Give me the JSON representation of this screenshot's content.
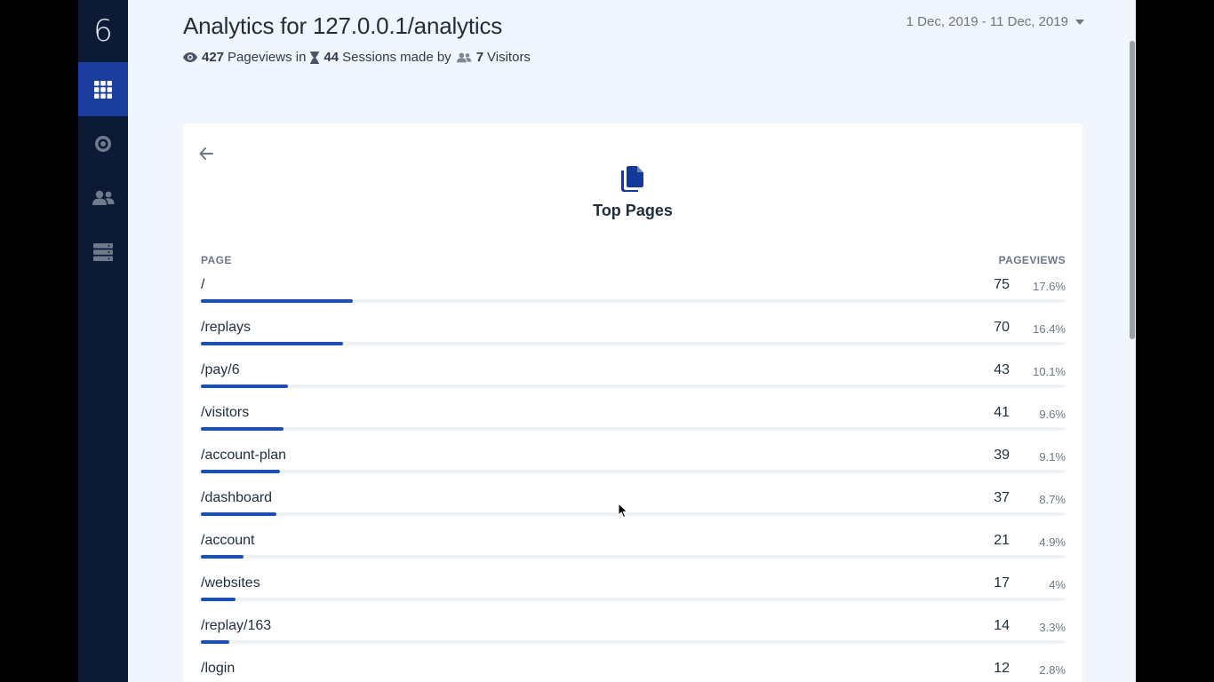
{
  "sidebar": {
    "logo": "6",
    "items": [
      {
        "name": "grid-icon",
        "active": true
      },
      {
        "name": "target-icon",
        "active": false
      },
      {
        "name": "users-icon",
        "active": false
      },
      {
        "name": "server-icon",
        "active": false
      }
    ]
  },
  "header": {
    "title": "Analytics for 127.0.0.1/analytics",
    "stats": {
      "pageviews_count": "427",
      "pageviews_label": "Pageviews in",
      "sessions_count": "44",
      "sessions_label": "Sessions made by",
      "visitors_count": "7",
      "visitors_label": "Visitors"
    },
    "date_range": "1 Dec, 2019 - 11 Dec, 2019"
  },
  "card": {
    "title": "Top Pages",
    "col_page": "PAGE",
    "col_views": "PAGEVIEWS",
    "rows": [
      {
        "page": "/",
        "count": "75",
        "pct": "17.6%",
        "share": 0.176
      },
      {
        "page": "/replays",
        "count": "70",
        "pct": "16.4%",
        "share": 0.164
      },
      {
        "page": "/pay/6",
        "count": "43",
        "pct": "10.1%",
        "share": 0.101
      },
      {
        "page": "/visitors",
        "count": "41",
        "pct": "9.6%",
        "share": 0.096
      },
      {
        "page": "/account-plan",
        "count": "39",
        "pct": "9.1%",
        "share": 0.091
      },
      {
        "page": "/dashboard",
        "count": "37",
        "pct": "8.7%",
        "share": 0.087
      },
      {
        "page": "/account",
        "count": "21",
        "pct": "4.9%",
        "share": 0.049
      },
      {
        "page": "/websites",
        "count": "17",
        "pct": "4%",
        "share": 0.04
      },
      {
        "page": "/replay/163",
        "count": "14",
        "pct": "3.3%",
        "share": 0.033
      },
      {
        "page": "/login",
        "count": "12",
        "pct": "2.8%",
        "share": 0.028
      }
    ]
  },
  "colors": {
    "sidebar_bg": "#0c1a36",
    "sidebar_active": "#1a3d9e",
    "accent": "#1a4fc4",
    "page_bg": "#f1f5fd"
  }
}
